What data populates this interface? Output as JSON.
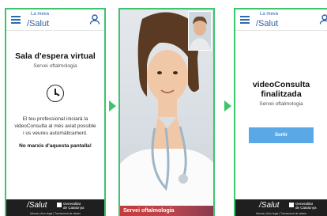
{
  "header": {
    "brand_small": "La meva",
    "brand_big": "/Salut"
  },
  "screen1": {
    "title": "Sala d'espera virtual",
    "subtitle": "Servei oftalmologia",
    "message": "El teu professional iniciarà la videoConsulta al més aviat possible i us veureu automàticament.",
    "warning": "No marxis d'aquesta pantalla!"
  },
  "footer": {
    "logo": "/Salut",
    "generalitat_line1": "Generalitat",
    "generalitat_line2": "de Catalunya",
    "links": "Idioma | Avís legal | Tractament de dades"
  },
  "screen2": {
    "caption": "Servei oftalmologia"
  },
  "screen3": {
    "title_line1": "videoConsulta",
    "title_line2": "finalitzada",
    "subtitle": "Servei oftalmologia",
    "button": "Sortir"
  },
  "colors": {
    "accent": "#3ec46d",
    "brand": "#2b5fa8",
    "button": "#5aa8e6",
    "caption_bar": "#c63a3a"
  }
}
